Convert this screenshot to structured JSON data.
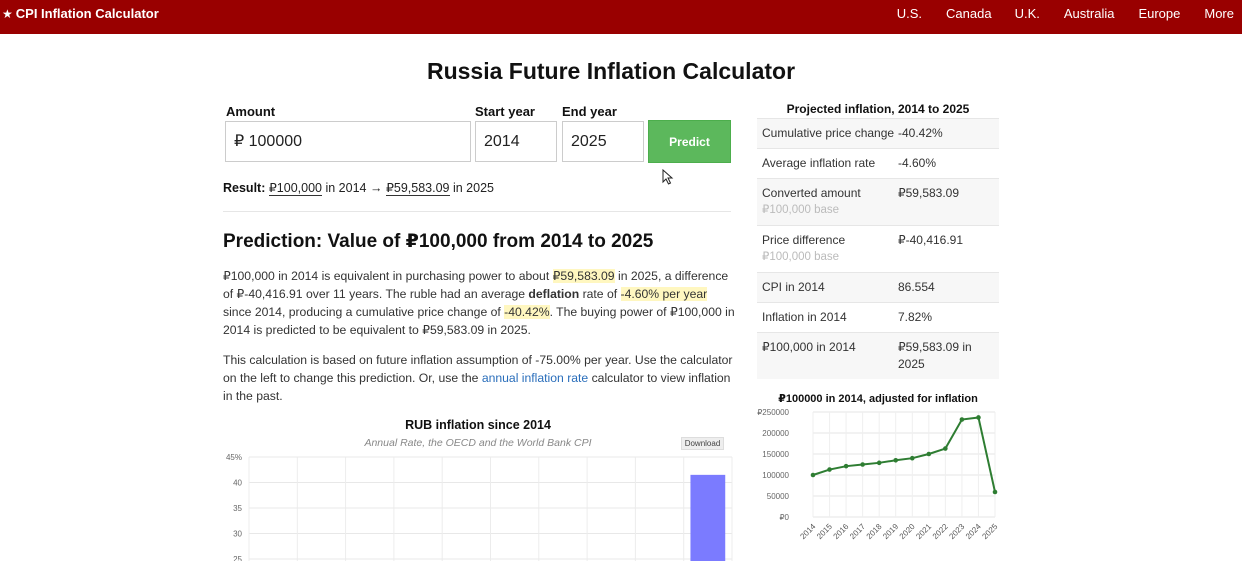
{
  "header": {
    "brand": "CPI Inflation Calculator",
    "nav": [
      "U.S.",
      "Canada",
      "U.K.",
      "Australia",
      "Europe",
      "More"
    ]
  },
  "page_title": "Russia Future Inflation Calculator",
  "form": {
    "amount_label": "Amount",
    "amount_value": "₽ 100000",
    "start_label": "Start year",
    "start_value": "2014",
    "end_label": "End year",
    "end_value": "2025",
    "predict_label": "Predict"
  },
  "result": {
    "label": "Result:",
    "amount": "₽100,000",
    "in1": " in 2014 → ",
    "converted": "₽59,583.09",
    "in2": " in 2025"
  },
  "prediction": {
    "heading": "Prediction: Value of ₽100,000 from 2014 to 2025",
    "p1": {
      "a": "₽100,000 in 2014 is equivalent in purchasing power to about ",
      "b": "₽59,583.09",
      "c": " in 2025, a difference of ₽-40,416.91 over 11 years. The ruble had an average ",
      "d": "deflation",
      "e": " rate of ",
      "f": "-4.60% per year",
      "g": " since 2014, producing a cumulative price change of ",
      "h": "-40.42%",
      "i": ". The buying power of ₽100,000 in 2014 is predicted to be equivalent to ₽59,583.09 in 2025."
    },
    "p2": {
      "a": "This calculation is based on future inflation assumption of -75.00% per year. Use the calculator on the left to change this prediction. Or, use the ",
      "link": "annual inflation rate",
      "b": " calculator to view inflation in the past."
    }
  },
  "rub_chart": {
    "title": "RUB inflation since 2014",
    "subtitle": "Annual Rate, the OECD and the World Bank CPI",
    "download_label": "Download",
    "bar_color": "#7b7bff"
  },
  "sidebar": {
    "title": "Projected inflation, 2014 to 2025",
    "rows": [
      {
        "k": "Cumulative price change",
        "v": "-40.42%",
        "sub": ""
      },
      {
        "k": "Average inflation rate",
        "v": "-4.60%",
        "sub": ""
      },
      {
        "k": "Converted amount",
        "v": "₽59,583.09",
        "sub": "₽100,000 base"
      },
      {
        "k": "Price difference",
        "v": "₽-40,416.91",
        "sub": "₽100,000 base"
      },
      {
        "k": "CPI in 2014",
        "v": "86.554",
        "sub": ""
      },
      {
        "k": "Inflation in 2014",
        "v": "7.82%",
        "sub": ""
      },
      {
        "k": "₽100,000 in 2014",
        "v": "₽59,583.09 in 2025",
        "sub": ""
      }
    ],
    "mini_chart_title": "₽100000 in 2014, adjusted for inflation"
  },
  "chart_data": [
    {
      "type": "line",
      "title": "₽100000 in 2014, adjusted for inflation",
      "x": [
        "2014",
        "2015",
        "2016",
        "2017",
        "2018",
        "2019",
        "2020",
        "2021",
        "2022",
        "2023",
        "2024",
        "2025"
      ],
      "series": [
        {
          "values": [
            100000,
            113000,
            121000,
            125000,
            129000,
            135000,
            140000,
            150000,
            163000,
            232000,
            237000,
            59583
          ]
        }
      ],
      "yticks": [
        "₽0",
        "50000",
        "100000",
        "150000",
        "200000",
        "₽250000"
      ],
      "ylim": [
        0,
        250000
      ],
      "color": "#2e7d32",
      "grid": true
    },
    {
      "type": "bar",
      "title": "RUB inflation since 2014",
      "subtitle": "Annual Rate, the OECD and the World Bank CPI",
      "yticks": [
        "45%",
        "40",
        "35",
        "30",
        "25"
      ],
      "ylim": [
        25,
        45
      ],
      "categories": [
        "",
        "",
        "",
        "",
        "",
        "",
        "",
        "",
        "",
        ""
      ],
      "values": [
        null,
        null,
        null,
        null,
        null,
        null,
        null,
        null,
        null,
        41.5
      ],
      "color": "#7b7bff",
      "grid": true
    }
  ]
}
